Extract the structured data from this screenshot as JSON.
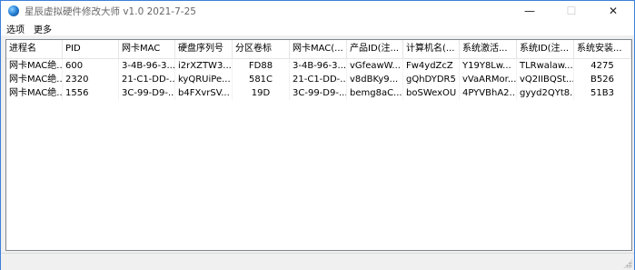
{
  "window": {
    "title": "星辰虚拟硬件修改大师 v1.0 2021-7-25",
    "minimize_glyph": "—",
    "maximize_glyph": "☐",
    "close_glyph": "✕"
  },
  "menu": {
    "items": [
      "选项",
      "更多"
    ]
  },
  "table": {
    "columns": [
      "进程名",
      "PID",
      "网卡MAC",
      "硬盘序列号",
      "分区卷标",
      "网卡MAC(...",
      "产品ID(注...",
      "计算机名(...",
      "系统激活...",
      "系统ID(注...",
      "系统安装..."
    ],
    "rows": [
      [
        "网卡MAC绝...",
        "600",
        "3-4B-96-3...",
        "i2rXZTW3...",
        "FD88",
        "3-4B-96-3...",
        "vGfeawW...",
        "Fw4ydZcZ",
        "Y19Y8Lw...",
        "TLRwalaw...",
        "4275"
      ],
      [
        "网卡MAC绝...",
        "2320",
        "21-C1-DD-...",
        "kyQRUiPe...",
        "581C",
        "21-C1-DD-...",
        "v8dBKy9...",
        "gQhDYDR5",
        "vVaARMor...",
        "vQ2IIBQSt...",
        "B526"
      ],
      [
        "网卡MAC绝...",
        "1556",
        "3C-99-D9-...",
        "b4FXvrSV...",
        "19D",
        "3C-99-D9-...",
        "bemg8aC...",
        "boSWexOU",
        "4PYVBhA2...",
        "gyyd2QYt8...",
        "51B3"
      ]
    ]
  }
}
